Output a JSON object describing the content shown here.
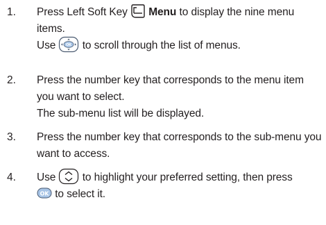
{
  "steps": [
    {
      "number": "1.",
      "a": "Press Left Soft Key",
      "b": "Menu",
      "c": "to display the nine menu items.",
      "d": "Use",
      "e": "to scroll through the list of menus."
    },
    {
      "number": "2.",
      "a": "Press the number key that corresponds to the menu item you want to select.",
      "b": "The sub-menu list will be displayed."
    },
    {
      "number": "3.",
      "a": "Press the number key that corresponds to the sub-menu you want to access."
    },
    {
      "number": "4.",
      "a": "Use",
      "b": "to highlight your preferred setting, then press",
      "c": "to select it."
    }
  ],
  "icons": {
    "left_soft_key": "left-soft-key-icon",
    "navigation_key": "navigation-key-icon",
    "up_down_key": "up-down-navigation-key-icon",
    "ok_key": "ok-key-icon"
  },
  "ok_key_label": "OK",
  "colors": {
    "text": "#231f20",
    "key_fill": "#a7c4e6",
    "key_outline": "#4a5a70"
  }
}
